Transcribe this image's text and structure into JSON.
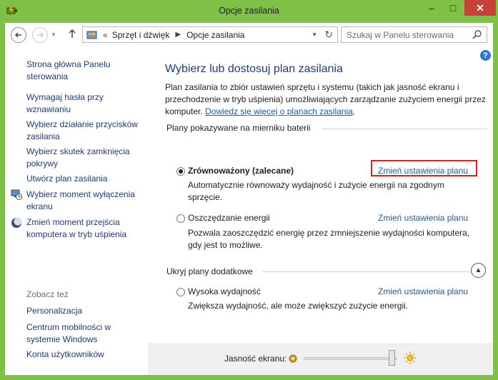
{
  "window": {
    "title": "Opcje zasilania",
    "minimize": "–",
    "maximize": "□",
    "close": "✕"
  },
  "addressbar": {
    "back_icon": "back-arrow-icon",
    "forward_icon": "forward-arrow-icon",
    "up_icon": "up-arrow-icon",
    "separator": "«",
    "breadcrumbs": [
      "Sprzęt i dźwięk",
      "Opcje zasilania"
    ],
    "search_placeholder": "Szukaj w Panelu sterowania"
  },
  "sidebar": {
    "items": [
      {
        "label": "Strona główna Panelu sterowania"
      },
      {
        "label": "Wymagaj hasła przy wznawianiu"
      },
      {
        "label": "Wybierz działanie przycisków zasilania"
      },
      {
        "label": "Wybierz skutek zamknięcia pokrywy"
      },
      {
        "label": "Utwórz plan zasilania"
      },
      {
        "label": "Wybierz moment wyłączenia ekranu",
        "icon": "monitor-clock-icon"
      },
      {
        "label": "Zmień moment przejścia komputera w tryb uśpienia",
        "icon": "moon-icon"
      }
    ],
    "see_also_title": "Zobacz też",
    "see_also": [
      {
        "label": "Personalizacja"
      },
      {
        "label": "Centrum mobilności w systemie Windows"
      },
      {
        "label": "Konta użytkowników"
      }
    ]
  },
  "main": {
    "help": "?",
    "title": "Wybierz lub dostosuj plan zasilania",
    "intro_text": "Plan zasilania to zbiór ustawień sprzętu i systemu (takich jak jasność ekranu i przechodzenie w tryb uśpienia) umożliwiających zarządzanie zużyciem energii przez komputer.",
    "intro_link": "Dowiedz się więcej o planach zasilania",
    "intro_end": ".",
    "group1_title": "Plany pokazywane na mierniku baterii",
    "group2_title": "Ukryj plany dodatkowe",
    "plans": [
      {
        "name": "Zrównoważony (zalecane)",
        "selected": true,
        "desc": "Automatycznie równoważy wydajność i zużycie energii na zgodnym sprzęcie.",
        "link": "Zmień ustawienia planu"
      },
      {
        "name": "Oszczędzanie energii",
        "selected": false,
        "desc": "Pozwala zaoszczędzić energię przez zmniejszenie wydajności komputera, gdy jest to możliwe.",
        "link": "Zmień ustawienia planu"
      },
      {
        "name": "Wysoka wydajność",
        "selected": false,
        "desc": "Zwiększa wydajność, ale może zwiększyć zużycie energii.",
        "link": "Zmień ustawienia planu"
      }
    ]
  },
  "footer": {
    "brightness_label": "Jasność ekranu:",
    "brightness_level": 0.95
  },
  "colors": {
    "frame": "#7fc047",
    "link": "#1e5aa8",
    "highlight": "#d9241b"
  }
}
